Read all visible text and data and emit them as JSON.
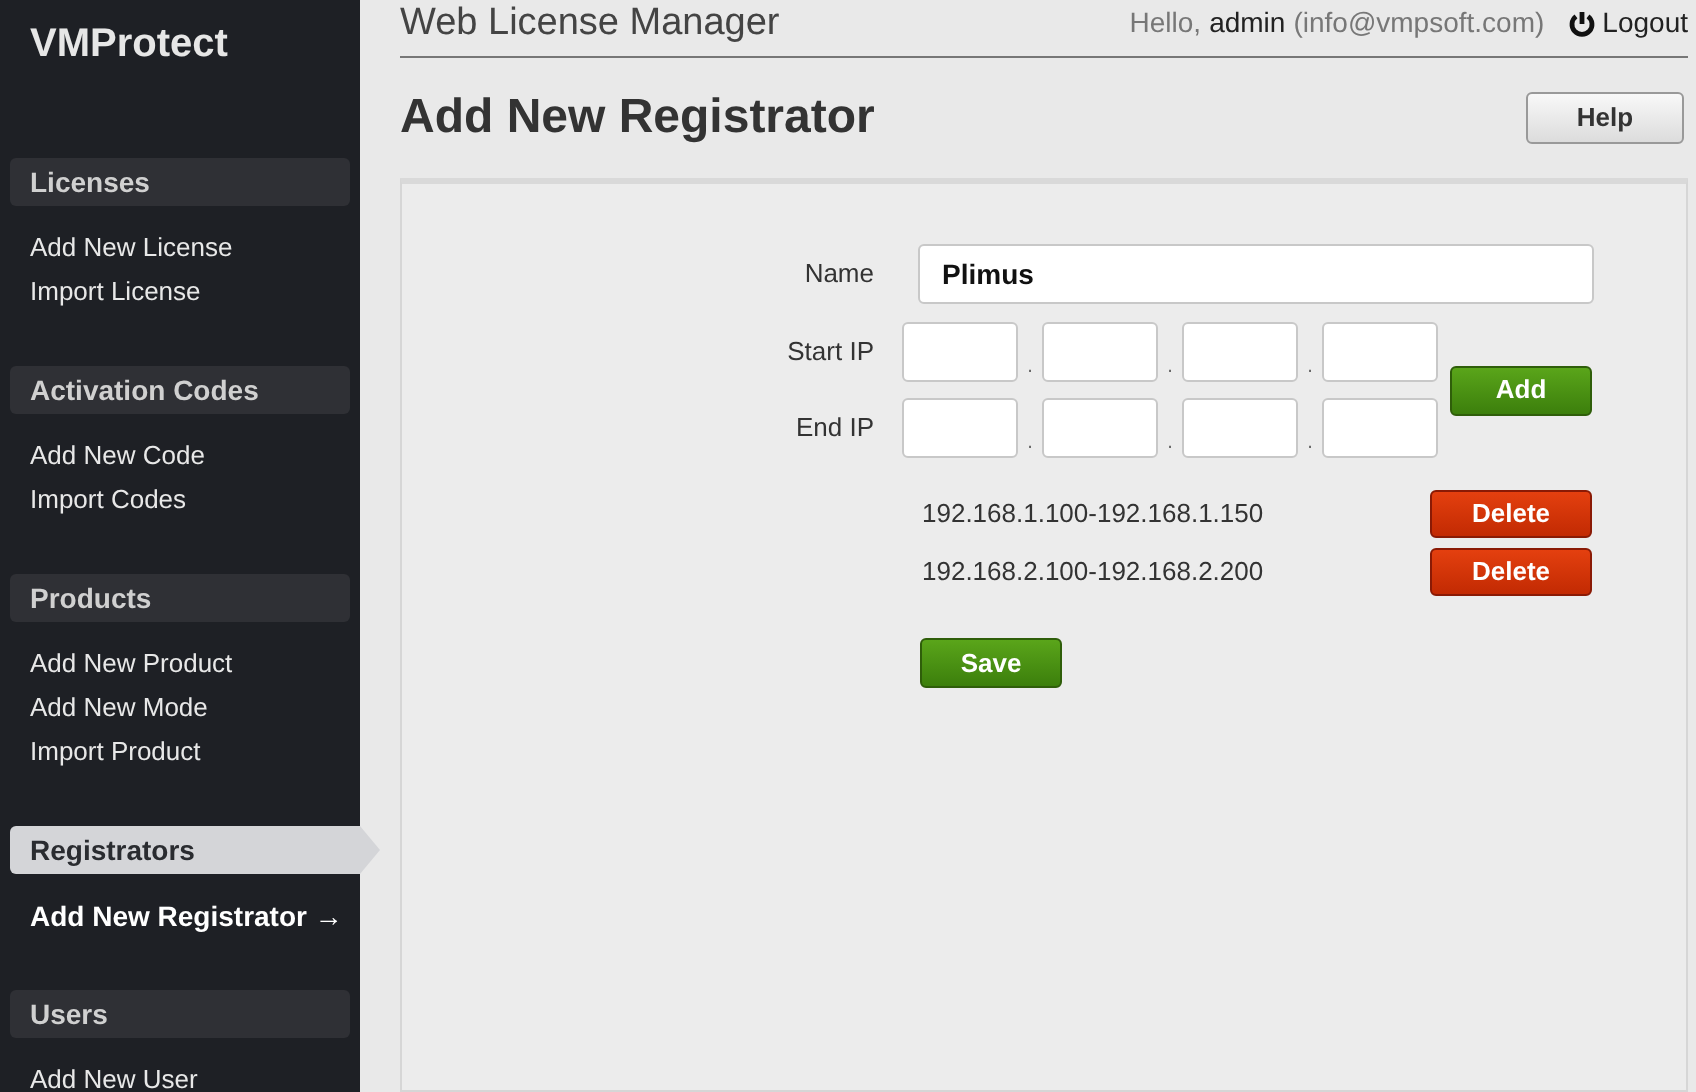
{
  "sidebar": {
    "logo": "VMProtect",
    "sections": [
      {
        "title": "Licenses",
        "selected": false,
        "items": [
          {
            "label": "Add New License",
            "selected": false
          },
          {
            "label": "Import License",
            "selected": false
          }
        ]
      },
      {
        "title": "Activation Codes",
        "selected": false,
        "items": [
          {
            "label": "Add New Code",
            "selected": false
          },
          {
            "label": "Import Codes",
            "selected": false
          }
        ]
      },
      {
        "title": "Products",
        "selected": false,
        "items": [
          {
            "label": "Add New Product",
            "selected": false
          },
          {
            "label": "Add New Mode",
            "selected": false
          },
          {
            "label": "Import Product",
            "selected": false
          }
        ]
      },
      {
        "title": "Registrators",
        "selected": true,
        "items": [
          {
            "label": "Add New Registrator →",
            "selected": true
          }
        ]
      },
      {
        "title": "Users",
        "selected": false,
        "items": [
          {
            "label": "Add New User",
            "selected": false
          }
        ]
      }
    ]
  },
  "header": {
    "app_title": "Web License Manager",
    "greeting": "Hello,",
    "user": "admin",
    "email": "(info@vmpsoft.com)",
    "logout": "Logout"
  },
  "page": {
    "title": "Add New Registrator",
    "help_button": "Help"
  },
  "form": {
    "name_label": "Name",
    "name_value": "Plimus",
    "ip_rows": [
      {
        "label": "Start IP",
        "separators": [
          ".",
          ".",
          "."
        ]
      },
      {
        "label": "End IP",
        "separators": [
          ".",
          ".",
          "."
        ]
      }
    ],
    "add_button": "Add",
    "ranges": [
      {
        "range": "192.168.1.100-192.168.1.150",
        "button": "Delete"
      },
      {
        "range": "192.168.2.100-192.168.2.200",
        "button": "Delete"
      }
    ],
    "save_button": "Save"
  }
}
